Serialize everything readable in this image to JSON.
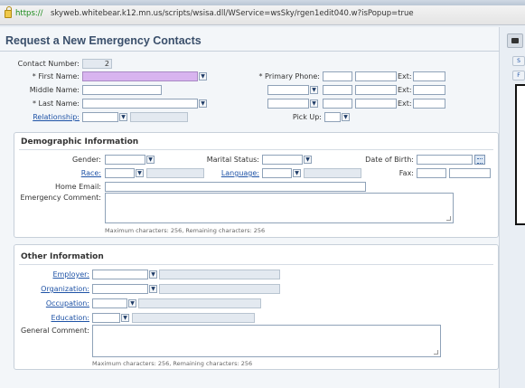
{
  "browser": {
    "url_scheme": "https://",
    "url_rest": "skyweb.whitebear.k12.mn.us/scripts/wsisa.dll/WService=wsSky/rgen1edit040.w?isPopup=true"
  },
  "page": {
    "title": "Request a New Emergency Contacts"
  },
  "contact": {
    "contact_number_label": "Contact Number:",
    "contact_number_value": "2",
    "first_name_label": "* First Name:",
    "middle_name_label": "Middle Name:",
    "last_name_label": "* Last Name:",
    "relationship_label": "Relationship:",
    "primary_phone_label": "* Primary Phone:",
    "ext_label": "Ext:",
    "pick_up_label": "Pick Up:"
  },
  "demographic": {
    "title": "Demographic Information",
    "gender_label": "Gender:",
    "marital_status_label": "Marital Status:",
    "dob_label": "Date of Birth:",
    "race_label": "Race:",
    "language_label": "Language:",
    "fax_label": "Fax:",
    "home_email_label": "Home Email:",
    "emergency_comment_label": "Emergency Comment:",
    "note": "Maximum characters: 256, Remaining characters: 256"
  },
  "other": {
    "title": "Other Information",
    "employer_label": "Employer:",
    "organization_label": "Organization:",
    "occupation_label": "Occupation:",
    "education_label": "Education:",
    "general_comment_label": "General Comment:",
    "note": "Maximum characters: 256, Remaining characters: 256"
  },
  "side": {
    "button1": "S",
    "button2": "F"
  },
  "colors": {
    "title": "#3a4f6b",
    "link": "#1f53a6",
    "required_fill": "#d8b4ef"
  },
  "icons": [
    "lock-icon",
    "camera-icon",
    "calendar-icon",
    "chevron-down-icon"
  ]
}
